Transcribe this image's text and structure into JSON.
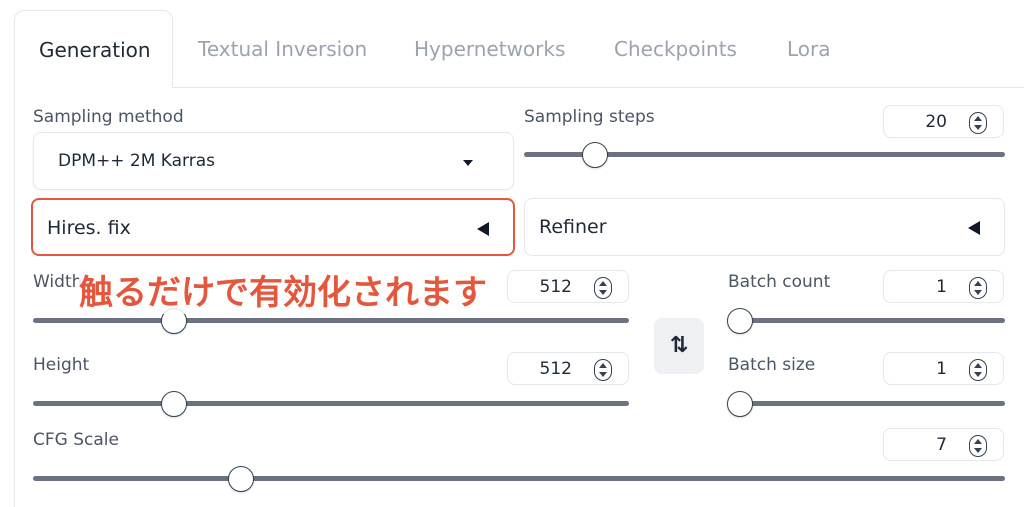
{
  "tabs": [
    {
      "label": "Generation",
      "active": true
    },
    {
      "label": "Textual Inversion",
      "active": false
    },
    {
      "label": "Hypernetworks",
      "active": false
    },
    {
      "label": "Checkpoints",
      "active": false
    },
    {
      "label": "Lora",
      "active": false
    }
  ],
  "sampling_method": {
    "label": "Sampling method",
    "value": "DPM++ 2M Karras"
  },
  "sampling_steps": {
    "label": "Sampling steps",
    "value": "20"
  },
  "hires_fix": {
    "label": "Hires. fix"
  },
  "refiner": {
    "label": "Refiner"
  },
  "annotation": {
    "text": "触るだけで有効化されます",
    "color": "#e4573d"
  },
  "width": {
    "label": "Width",
    "value": "512"
  },
  "height": {
    "label": "Height",
    "value": "512"
  },
  "swap_button": {
    "label": "⇅"
  },
  "batch_count": {
    "label": "Batch count",
    "value": "1"
  },
  "batch_size": {
    "label": "Batch size",
    "value": "1"
  },
  "cfg_scale": {
    "label": "CFG Scale",
    "value": "7"
  },
  "icons": {
    "spinner": "number-spinner-icon",
    "dropdown": "chevron-down-icon",
    "accordion": "triangle-left-icon",
    "swap": "swap-arrows-icon"
  }
}
